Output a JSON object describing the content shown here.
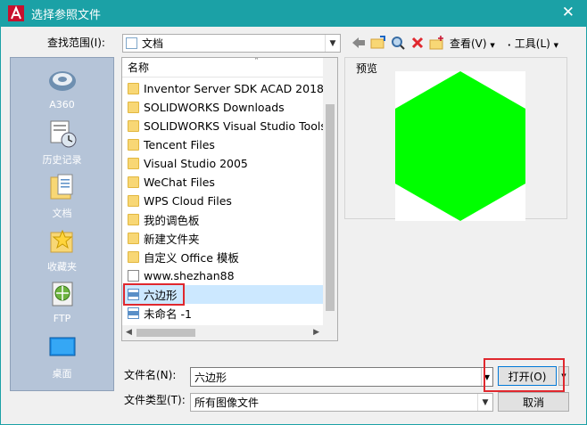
{
  "window": {
    "title": "选择参照文件",
    "close_glyph": "✕"
  },
  "lookin": {
    "label": "查找范围(I):",
    "value": "文档"
  },
  "toolbar": {
    "view_label": "查看(V)",
    "tools_label": "工具(L)",
    "arrow": "▼"
  },
  "places": [
    {
      "label": "A360",
      "icon": "a360-cloud-icon"
    },
    {
      "label": "历史记录",
      "icon": "history-icon"
    },
    {
      "label": "文档",
      "icon": "documents-icon"
    },
    {
      "label": "收藏夹",
      "icon": "favorites-icon"
    },
    {
      "label": "FTP",
      "icon": "ftp-icon"
    },
    {
      "label": "桌面",
      "icon": "desktop-icon"
    }
  ],
  "filelist": {
    "column_header": "名称",
    "items": [
      {
        "name": "Inventor Server SDK ACAD 2018",
        "type": "folder"
      },
      {
        "name": "SOLIDWORKS Downloads",
        "type": "folder"
      },
      {
        "name": "SOLIDWORKS Visual Studio Tools",
        "type": "folder"
      },
      {
        "name": "Tencent Files",
        "type": "folder"
      },
      {
        "name": "Visual Studio 2005",
        "type": "folder"
      },
      {
        "name": "WeChat Files",
        "type": "folder"
      },
      {
        "name": "WPS Cloud Files",
        "type": "folder"
      },
      {
        "name": "我的调色板",
        "type": "folder"
      },
      {
        "name": "新建文件夹",
        "type": "folder"
      },
      {
        "name": "自定义 Office 模板",
        "type": "folder"
      },
      {
        "name": "www.shezhan88",
        "type": "file"
      },
      {
        "name": "六边形",
        "type": "jpg",
        "selected": true
      },
      {
        "name": "未命名 -1",
        "type": "jpg"
      }
    ]
  },
  "preview": {
    "label": "预览",
    "shape_color": "#00ff00"
  },
  "filename": {
    "label": "文件名(N):",
    "value": "六边形"
  },
  "filetype": {
    "label": "文件类型(T):",
    "value": "所有图像文件"
  },
  "buttons": {
    "open": "打开(O)",
    "cancel": "取消"
  },
  "colors": {
    "titlebar": "#1ba1a6",
    "highlight": "#e0282e"
  }
}
